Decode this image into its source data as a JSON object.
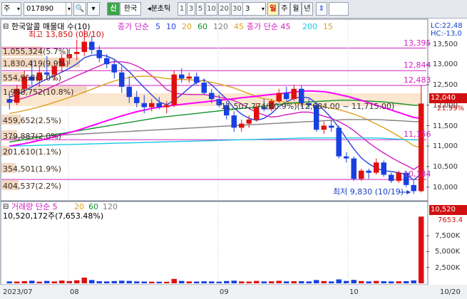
{
  "toolbar": {
    "market_selector": "주",
    "stock_code": "017890",
    "credit_badge": "신",
    "stock_name": "한국",
    "timeframe_label": "◂분초틱",
    "intervals": [
      "1",
      "3",
      "5",
      "10",
      "20",
      "30"
    ],
    "count_value": "3",
    "period_tabs": [
      "일",
      "주",
      "월",
      "년"
    ],
    "period_selected": "일"
  },
  "price_panel": {
    "legend": {
      "stock_title": "한국알콜 매물대 수(10)",
      "ma_label": "종가 단순",
      "ma_periods": [
        "5",
        "10",
        "20",
        "60",
        "120",
        "45"
      ],
      "ma_colors": [
        "#2a3fe0",
        "#2a3fe0",
        "#e0a020",
        "#13932c",
        "#808080",
        "#e0a020"
      ],
      "ma2_label": "종가 단순 45",
      "ma2_periods": [
        "200",
        "15"
      ],
      "ma2_colors": [
        "#19c9e6",
        "#e0a020"
      ]
    },
    "high_marker": "최고 13,850 (08/10)",
    "low_marker": "최저 9,830 (10/19)",
    "range_text": "11,507,774(60.9%)(12,084.00 ~ 11,715.00)",
    "volume_profile": [
      {
        "label": "1,055,324(5.7%)"
      },
      {
        "label": "1,830,419(9.9%)"
      },
      {
        "label": "554,958(3.0%)"
      },
      {
        "label": "1,998,752(10.8%)"
      },
      {
        "label": "459,652(2.5%)"
      },
      {
        "label": "379,887(2.0%)"
      },
      {
        "label": "201,610(1.1%)"
      },
      {
        "label": "354,501(1.9%)"
      },
      {
        "label": "404,537(2.2%)"
      }
    ],
    "hlines": [
      {
        "label": "13,395",
        "value": 13395
      },
      {
        "label": "12,844",
        "value": 12844
      },
      {
        "label": "12,483",
        "value": 12483
      },
      {
        "label": "11,156",
        "value": 11156
      },
      {
        "label": "10,184",
        "value": 10184
      }
    ],
    "axis_labels": [
      "13,500",
      "13,000",
      "12,500",
      "12,000",
      "11,500",
      "11,000",
      "10,500",
      "10,000"
    ],
    "axis_values": [
      13500,
      13000,
      12500,
      12000,
      11500,
      11000,
      10500,
      10000
    ],
    "right_top_lc": "LC:22,48",
    "right_top_hc": "HC:-13,0",
    "current_price": "12,040",
    "current_change": "21.99%",
    "current_value": 12040
  },
  "volume_panel": {
    "title": "거래량 단순 5",
    "ma_periods": [
      "20",
      "60",
      "120"
    ],
    "ma_colors": [
      "#e0a020",
      "#13932c",
      "#808080"
    ],
    "detail": "10,520,172주(7,653.48%)",
    "axis_labels": [
      "7,500K",
      "5,000K",
      "2,500K"
    ],
    "axis_values": [
      7500,
      5000,
      2500
    ],
    "current_volume": "10,520",
    "current_ratio": "7653.4"
  },
  "xaxis": {
    "labels": [
      "2023/07",
      "08",
      "09",
      "10",
      "10/20"
    ]
  },
  "chart_data": {
    "type": "candlestick",
    "y_range": [
      9700,
      13700
    ],
    "volume_range_k": [
      0,
      11000
    ],
    "candles": [
      {
        "o": 12150,
        "h": 12350,
        "l": 11900,
        "c": 12060
      },
      {
        "o": 12060,
        "h": 12500,
        "l": 12000,
        "c": 12400
      },
      {
        "o": 12400,
        "h": 12850,
        "l": 12300,
        "c": 12700
      },
      {
        "o": 12700,
        "h": 13100,
        "l": 12500,
        "c": 12600
      },
      {
        "o": 12600,
        "h": 12950,
        "l": 12450,
        "c": 12800
      },
      {
        "o": 12800,
        "h": 13200,
        "l": 12650,
        "c": 12750
      },
      {
        "o": 12750,
        "h": 13050,
        "l": 12600,
        "c": 12950
      },
      {
        "o": 12950,
        "h": 13250,
        "l": 12800,
        "c": 13150
      },
      {
        "o": 13150,
        "h": 13400,
        "l": 13000,
        "c": 13250
      },
      {
        "o": 13250,
        "h": 13600,
        "l": 13100,
        "c": 13300
      },
      {
        "o": 13300,
        "h": 13850,
        "l": 13200,
        "c": 13550
      },
      {
        "o": 13550,
        "h": 13700,
        "l": 13250,
        "c": 13350
      },
      {
        "o": 13350,
        "h": 13450,
        "l": 13050,
        "c": 13150
      },
      {
        "o": 13150,
        "h": 13250,
        "l": 12900,
        "c": 13000
      },
      {
        "o": 13000,
        "h": 13100,
        "l": 12650,
        "c": 12800
      },
      {
        "o": 12800,
        "h": 12950,
        "l": 12300,
        "c": 12450
      },
      {
        "o": 12450,
        "h": 12700,
        "l": 12050,
        "c": 12200
      },
      {
        "o": 12200,
        "h": 12350,
        "l": 11950,
        "c": 12050
      },
      {
        "o": 12050,
        "h": 12250,
        "l": 11800,
        "c": 11950
      },
      {
        "o": 11950,
        "h": 12150,
        "l": 11850,
        "c": 12050
      },
      {
        "o": 12050,
        "h": 12200,
        "l": 11900,
        "c": 11950
      },
      {
        "o": 11950,
        "h": 12100,
        "l": 11800,
        "c": 12000
      },
      {
        "o": 12000,
        "h": 12850,
        "l": 11950,
        "c": 12750
      },
      {
        "o": 12750,
        "h": 12900,
        "l": 12550,
        "c": 12650
      },
      {
        "o": 12650,
        "h": 12800,
        "l": 12550,
        "c": 12700
      },
      {
        "o": 12700,
        "h": 12800,
        "l": 12500,
        "c": 12550
      },
      {
        "o": 12550,
        "h": 12650,
        "l": 12250,
        "c": 12300
      },
      {
        "o": 12300,
        "h": 12400,
        "l": 12050,
        "c": 12150
      },
      {
        "o": 12150,
        "h": 12250,
        "l": 11950,
        "c": 12000
      },
      {
        "o": 12000,
        "h": 12100,
        "l": 11650,
        "c": 11750
      },
      {
        "o": 11750,
        "h": 11850,
        "l": 11350,
        "c": 11450
      },
      {
        "o": 11450,
        "h": 11650,
        "l": 11350,
        "c": 11550
      },
      {
        "o": 11550,
        "h": 11750,
        "l": 11450,
        "c": 11650
      },
      {
        "o": 11650,
        "h": 12050,
        "l": 11600,
        "c": 11950
      },
      {
        "o": 11950,
        "h": 12150,
        "l": 11850,
        "c": 11900
      },
      {
        "o": 11900,
        "h": 12150,
        "l": 11850,
        "c": 12100
      },
      {
        "o": 12100,
        "h": 12400,
        "l": 12050,
        "c": 12300
      },
      {
        "o": 12300,
        "h": 12450,
        "l": 12100,
        "c": 12150
      },
      {
        "o": 12150,
        "h": 12500,
        "l": 12100,
        "c": 12400
      },
      {
        "o": 12400,
        "h": 12480,
        "l": 11950,
        "c": 12050
      },
      {
        "o": 12050,
        "h": 12150,
        "l": 11900,
        "c": 12000
      },
      {
        "o": 12000,
        "h": 12050,
        "l": 11350,
        "c": 11400
      },
      {
        "o": 11400,
        "h": 11600,
        "l": 11300,
        "c": 11500
      },
      {
        "o": 11500,
        "h": 11650,
        "l": 11350,
        "c": 11450
      },
      {
        "o": 11450,
        "h": 11500,
        "l": 10700,
        "c": 10750
      },
      {
        "o": 10750,
        "h": 10850,
        "l": 10600,
        "c": 10700
      },
      {
        "o": 10700,
        "h": 10750,
        "l": 10150,
        "c": 10200
      },
      {
        "o": 10200,
        "h": 10450,
        "l": 10150,
        "c": 10400
      },
      {
        "o": 10400,
        "h": 10450,
        "l": 10200,
        "c": 10350
      },
      {
        "o": 10350,
        "h": 10700,
        "l": 10300,
        "c": 10600
      },
      {
        "o": 10600,
        "h": 10650,
        "l": 10250,
        "c": 10300
      },
      {
        "o": 10300,
        "h": 10350,
        "l": 10100,
        "c": 10150
      },
      {
        "o": 10150,
        "h": 10400,
        "l": 10100,
        "c": 10350
      },
      {
        "o": 10350,
        "h": 10400,
        "l": 10000,
        "c": 10050
      },
      {
        "o": 10050,
        "h": 10150,
        "l": 9830,
        "c": 9900
      },
      {
        "o": 9900,
        "h": 12480,
        "l": 9870,
        "c": 12040
      }
    ],
    "volumes_k": [
      300,
      280,
      350,
      420,
      260,
      380,
      300,
      440,
      360,
      480,
      900,
      520,
      330,
      300,
      360,
      420,
      380,
      300,
      280,
      260,
      250,
      240,
      700,
      380,
      300,
      280,
      320,
      300,
      260,
      360,
      420,
      300,
      280,
      380,
      300,
      320,
      400,
      300,
      340,
      330,
      300,
      520,
      360,
      300,
      620,
      380,
      540,
      360,
      300,
      380,
      330,
      300,
      320,
      340,
      460,
      10520
    ],
    "moving_averages": [
      {
        "name": "5",
        "color": "#2a3fe0",
        "values": [
          12200,
          12250,
          12350,
          12450,
          12550,
          12640,
          12720,
          12810,
          12900,
          13010,
          13160,
          13220,
          13230,
          13200,
          13120,
          12980,
          12820,
          12620,
          12430,
          12250,
          12080,
          12010,
          12120,
          12260,
          12420,
          12560,
          12620,
          12500,
          12320,
          12150,
          11930,
          11780,
          11680,
          11630,
          11680,
          11800,
          11970,
          12080,
          12170,
          12200,
          12180,
          12050,
          11880,
          11690,
          11450,
          11190,
          10930,
          10710,
          10570,
          10460,
          10400,
          10380,
          10350,
          10310,
          10170,
          10330
        ]
      },
      {
        "name": "10",
        "color": "#d020c0",
        "values": [
          12100,
          12130,
          12180,
          12240,
          12310,
          12390,
          12480,
          12560,
          12640,
          12720,
          12800,
          12880,
          12960,
          13040,
          13060,
          13060,
          13030,
          12960,
          12860,
          12720,
          12560,
          12380,
          12300,
          12270,
          12260,
          12260,
          12260,
          12230,
          12200,
          12160,
          12110,
          12030,
          11920,
          11830,
          11760,
          11710,
          11730,
          11770,
          11800,
          11830,
          11830,
          11790,
          11730,
          11680,
          11600,
          11500,
          11380,
          11230,
          11080,
          10950,
          10830,
          10720,
          10620,
          10530,
          10430,
          10550
        ]
      },
      {
        "name": "20",
        "color": "#e0a020",
        "values": [
          11800,
          11830,
          11870,
          11910,
          11960,
          12010,
          12070,
          12130,
          12190,
          12250,
          12320,
          12390,
          12460,
          12530,
          12590,
          12640,
          12680,
          12700,
          12710,
          12700,
          12680,
          12650,
          12640,
          12630,
          12620,
          12610,
          12590,
          12560,
          12520,
          12470,
          12420,
          12350,
          12280,
          12210,
          12160,
          12120,
          12090,
          12070,
          12050,
          12030,
          12010,
          11990,
          11960,
          11930,
          11890,
          11840,
          11780,
          11710,
          11630,
          11540,
          11450,
          11350,
          11240,
          11130,
          11010,
          10960
        ]
      },
      {
        "name": "60",
        "color": "#13932c",
        "values": [
          11100,
          11130,
          11160,
          11190,
          11220,
          11250,
          11280,
          11310,
          11340,
          11370,
          11400,
          11430,
          11460,
          11490,
          11520,
          11550,
          11580,
          11610,
          11640,
          11670,
          11700,
          11720,
          11740,
          11760,
          11780,
          11800,
          11820,
          11840,
          11860,
          11880,
          11900,
          11920,
          11940,
          11960,
          11980,
          12000,
          12020,
          12040,
          12060,
          12070,
          12080,
          12090,
          12100,
          12110,
          12120,
          12120,
          12120,
          12110,
          12100,
          12090,
          12080,
          12060,
          12040,
          12020,
          12000,
          12000
        ]
      },
      {
        "name": "120",
        "color": "#808080",
        "values": [
          11200,
          11210,
          11220,
          11230,
          11240,
          11250,
          11260,
          11270,
          11280,
          11290,
          11300,
          11310,
          11320,
          11330,
          11340,
          11350,
          11360,
          11370,
          11380,
          11390,
          11400,
          11410,
          11420,
          11430,
          11440,
          11450,
          11460,
          11470,
          11480,
          11490,
          11500,
          11510,
          11520,
          11530,
          11540,
          11550,
          11560,
          11570,
          11580,
          11590,
          11600,
          11610,
          11620,
          11630,
          11640,
          11650,
          11650,
          11650,
          11650,
          11650,
          11640,
          11630,
          11620,
          11610,
          11600,
          11600
        ]
      },
      {
        "name": "200",
        "color": "#19c9e6",
        "values": [
          11000,
          11005,
          11010,
          11015,
          11020,
          11025,
          11030,
          11035,
          11040,
          11045,
          11050,
          11055,
          11060,
          11065,
          11070,
          11075,
          11080,
          11085,
          11090,
          11095,
          11100,
          11105,
          11110,
          11115,
          11120,
          11125,
          11130,
          11135,
          11140,
          11145,
          11150,
          11155,
          11160,
          11165,
          11170,
          11175,
          11180,
          11185,
          11190,
          11195,
          11200,
          11200,
          11200,
          11200,
          11200,
          11200,
          11200,
          11200,
          11200,
          11200,
          11190,
          11180,
          11170,
          11160,
          11150,
          11150
        ]
      },
      {
        "name": "45",
        "color": "#ff00ff",
        "values": [
          11000,
          11030,
          11060,
          11100,
          11140,
          11180,
          11230,
          11280,
          11330,
          11380,
          11440,
          11500,
          11560,
          11620,
          11680,
          11740,
          11790,
          11840,
          11880,
          11920,
          11950,
          11980,
          12000,
          12020,
          12040,
          12060,
          12080,
          12100,
          12120,
          12140,
          12160,
          12180,
          12200,
          12220,
          12240,
          12260,
          12280,
          12300,
          12320,
          12340,
          12350,
          12340,
          12330,
          12300,
          12260,
          12220,
          12170,
          12120,
          12060,
          12000,
          11940,
          11880,
          11820,
          11760,
          11700,
          11680
        ]
      }
    ]
  }
}
